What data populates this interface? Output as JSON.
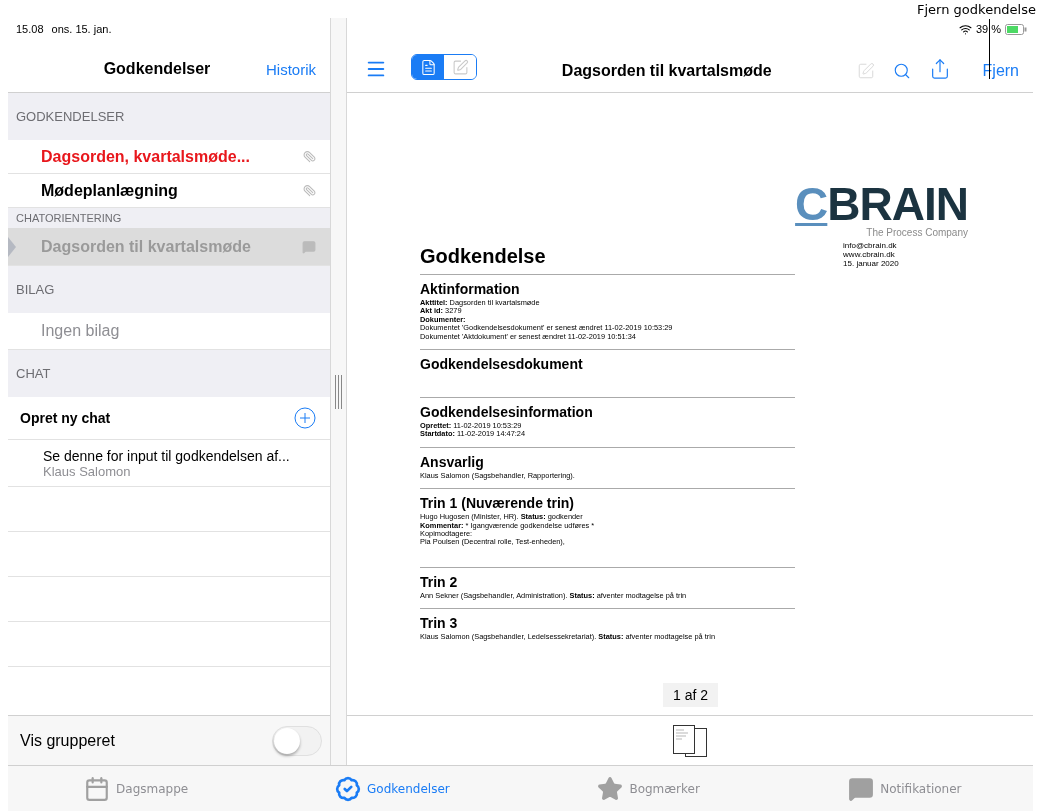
{
  "callout": {
    "text": "Fjern godkendelse"
  },
  "status_bar": {
    "time": "15.08",
    "date": "ons. 15. jan.",
    "battery": "39 %"
  },
  "sidebar": {
    "title": "Godkendelser",
    "action": "Historik",
    "sections": [
      {
        "heading": "GODKENDELSER",
        "kind": "group",
        "items": [
          {
            "kind": "approval",
            "label": "Dagsorden, kvartalsmøde...",
            "alert": true,
            "selected": false
          },
          {
            "kind": "approval",
            "label": "Mødeplanlægning",
            "alert": false,
            "selected": false
          }
        ]
      },
      {
        "heading": "CHATORIENTERING",
        "kind": "subgroup",
        "items": [
          {
            "kind": "chat",
            "label": "Dagsorden til kvartalsmøde",
            "alert": false,
            "selected": true
          }
        ]
      },
      {
        "heading": "BILAG",
        "kind": "group",
        "items": [
          {
            "kind": "empty",
            "label": "Ingen bilag"
          }
        ]
      },
      {
        "heading": "CHAT",
        "kind": "group",
        "items": [
          {
            "kind": "action",
            "label": "Opret ny chat"
          },
          {
            "kind": "message",
            "label": "Se denne for input til godkendelsen af...",
            "author": "Klaus Salomon"
          }
        ]
      }
    ],
    "toggle": {
      "label": "Vis grupperet",
      "on": false
    }
  },
  "toolbar": {
    "title": "Dagsorden til kvartalsmøde",
    "views": [
      {
        "selected": true
      },
      {
        "selected": false
      }
    ],
    "edit_disabled": true,
    "action": "Fjern"
  },
  "document": {
    "logo": "CBRAIN",
    "tagline": "The Process Company",
    "contact": [
      "info@cbrain.dk",
      "www.cbrain.dk",
      "15. januar 2020"
    ],
    "title": "Godkendelse",
    "sections": [
      {
        "heading": "Aktinformation",
        "lines": [
          "**Akttitel:** Dagsorden til kvartalsmøde",
          "**Akt id:** 3279",
          "**Dokumenter:**",
          "Dokumentet 'Godkendelsesdokument' er senest ændret 11-02-2019 10:53:29",
          "Dokumentet 'Aktdokument' er senest ændret 11-02-2019 10:51:34"
        ]
      },
      {
        "heading": "Godkendelsesdokument"
      },
      {
        "heading": "Godkendelsesinformation",
        "lines": [
          "**Oprettet:** 11-02-2019 10:53:29",
          "**Startdato:** 11-02-2019 14:47:24"
        ]
      },
      {
        "heading": "Ansvarlig",
        "lines": [
          "Klaus Salomon (Sagsbehandler, Rapportering)."
        ]
      },
      {
        "heading": "Trin 1 (Nuværende trin)",
        "lines": [
          "Hugo Hugosen (Minister, HR). **Status:** godkender",
          "**Kommentar:** * Igangværende godkendelse udføres *",
          "Kopimodtagere:",
          "Pia Poulsen (Decentral rolle, Test-enheden),"
        ]
      },
      {
        "heading": "Trin 2",
        "lines": [
          "Ann Sekner (Sagsbehandler, Administration). **Status:** afventer modtagelse på trin"
        ]
      },
      {
        "heading": "Trin 3",
        "lines": [
          "Klaus Salomon (Sagsbehandler, Ledelsessekretariat). **Status:** afventer modtagelse på trin"
        ]
      }
    ],
    "page_indicator": "1 af 2"
  },
  "tabs": [
    {
      "kind": "calendar",
      "label": "Dagsmappe",
      "selected": false
    },
    {
      "kind": "approval",
      "label": "Godkendelser",
      "selected": true
    },
    {
      "kind": "star",
      "label": "Bogmærker",
      "selected": false
    },
    {
      "kind": "chat",
      "label": "Notifikationer",
      "selected": false
    }
  ]
}
